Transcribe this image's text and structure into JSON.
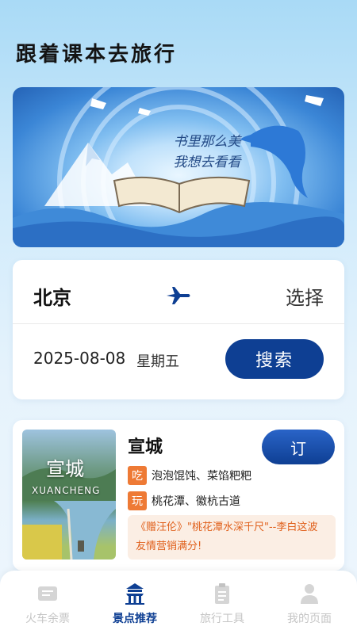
{
  "header": {
    "title": "跟着课本去旅行"
  },
  "banner": {
    "line1": "书里那么美",
    "line2": "我想去看看"
  },
  "trip": {
    "from_city": "北京",
    "select_label": "选择",
    "date": "2025-08-08",
    "weekday": "星期五",
    "search_label": "搜索"
  },
  "spot": {
    "thumb_cn": "宣城",
    "thumb_en": "XUANCHENG",
    "name": "宣城",
    "book_label": "订",
    "eat_badge": "吃",
    "eat_text": "泡泡馄饨、菜馅粑粑",
    "play_badge": "玩",
    "play_text": "桃花潭、徽杭古道",
    "quote": "《赠汪伦》\"桃花潭水深千尺\"--李白这波友情营销满分!"
  },
  "tabs": [
    {
      "label": "火车余票",
      "icon": "train-ticket-icon"
    },
    {
      "label": "景点推荐",
      "icon": "temple-icon"
    },
    {
      "label": "旅行工具",
      "icon": "clipboard-icon"
    },
    {
      "label": "我的页面",
      "icon": "user-icon"
    }
  ],
  "colors": {
    "primary": "#0e3f93",
    "accent": "#ee7a35",
    "quote_text": "#e0601c"
  }
}
